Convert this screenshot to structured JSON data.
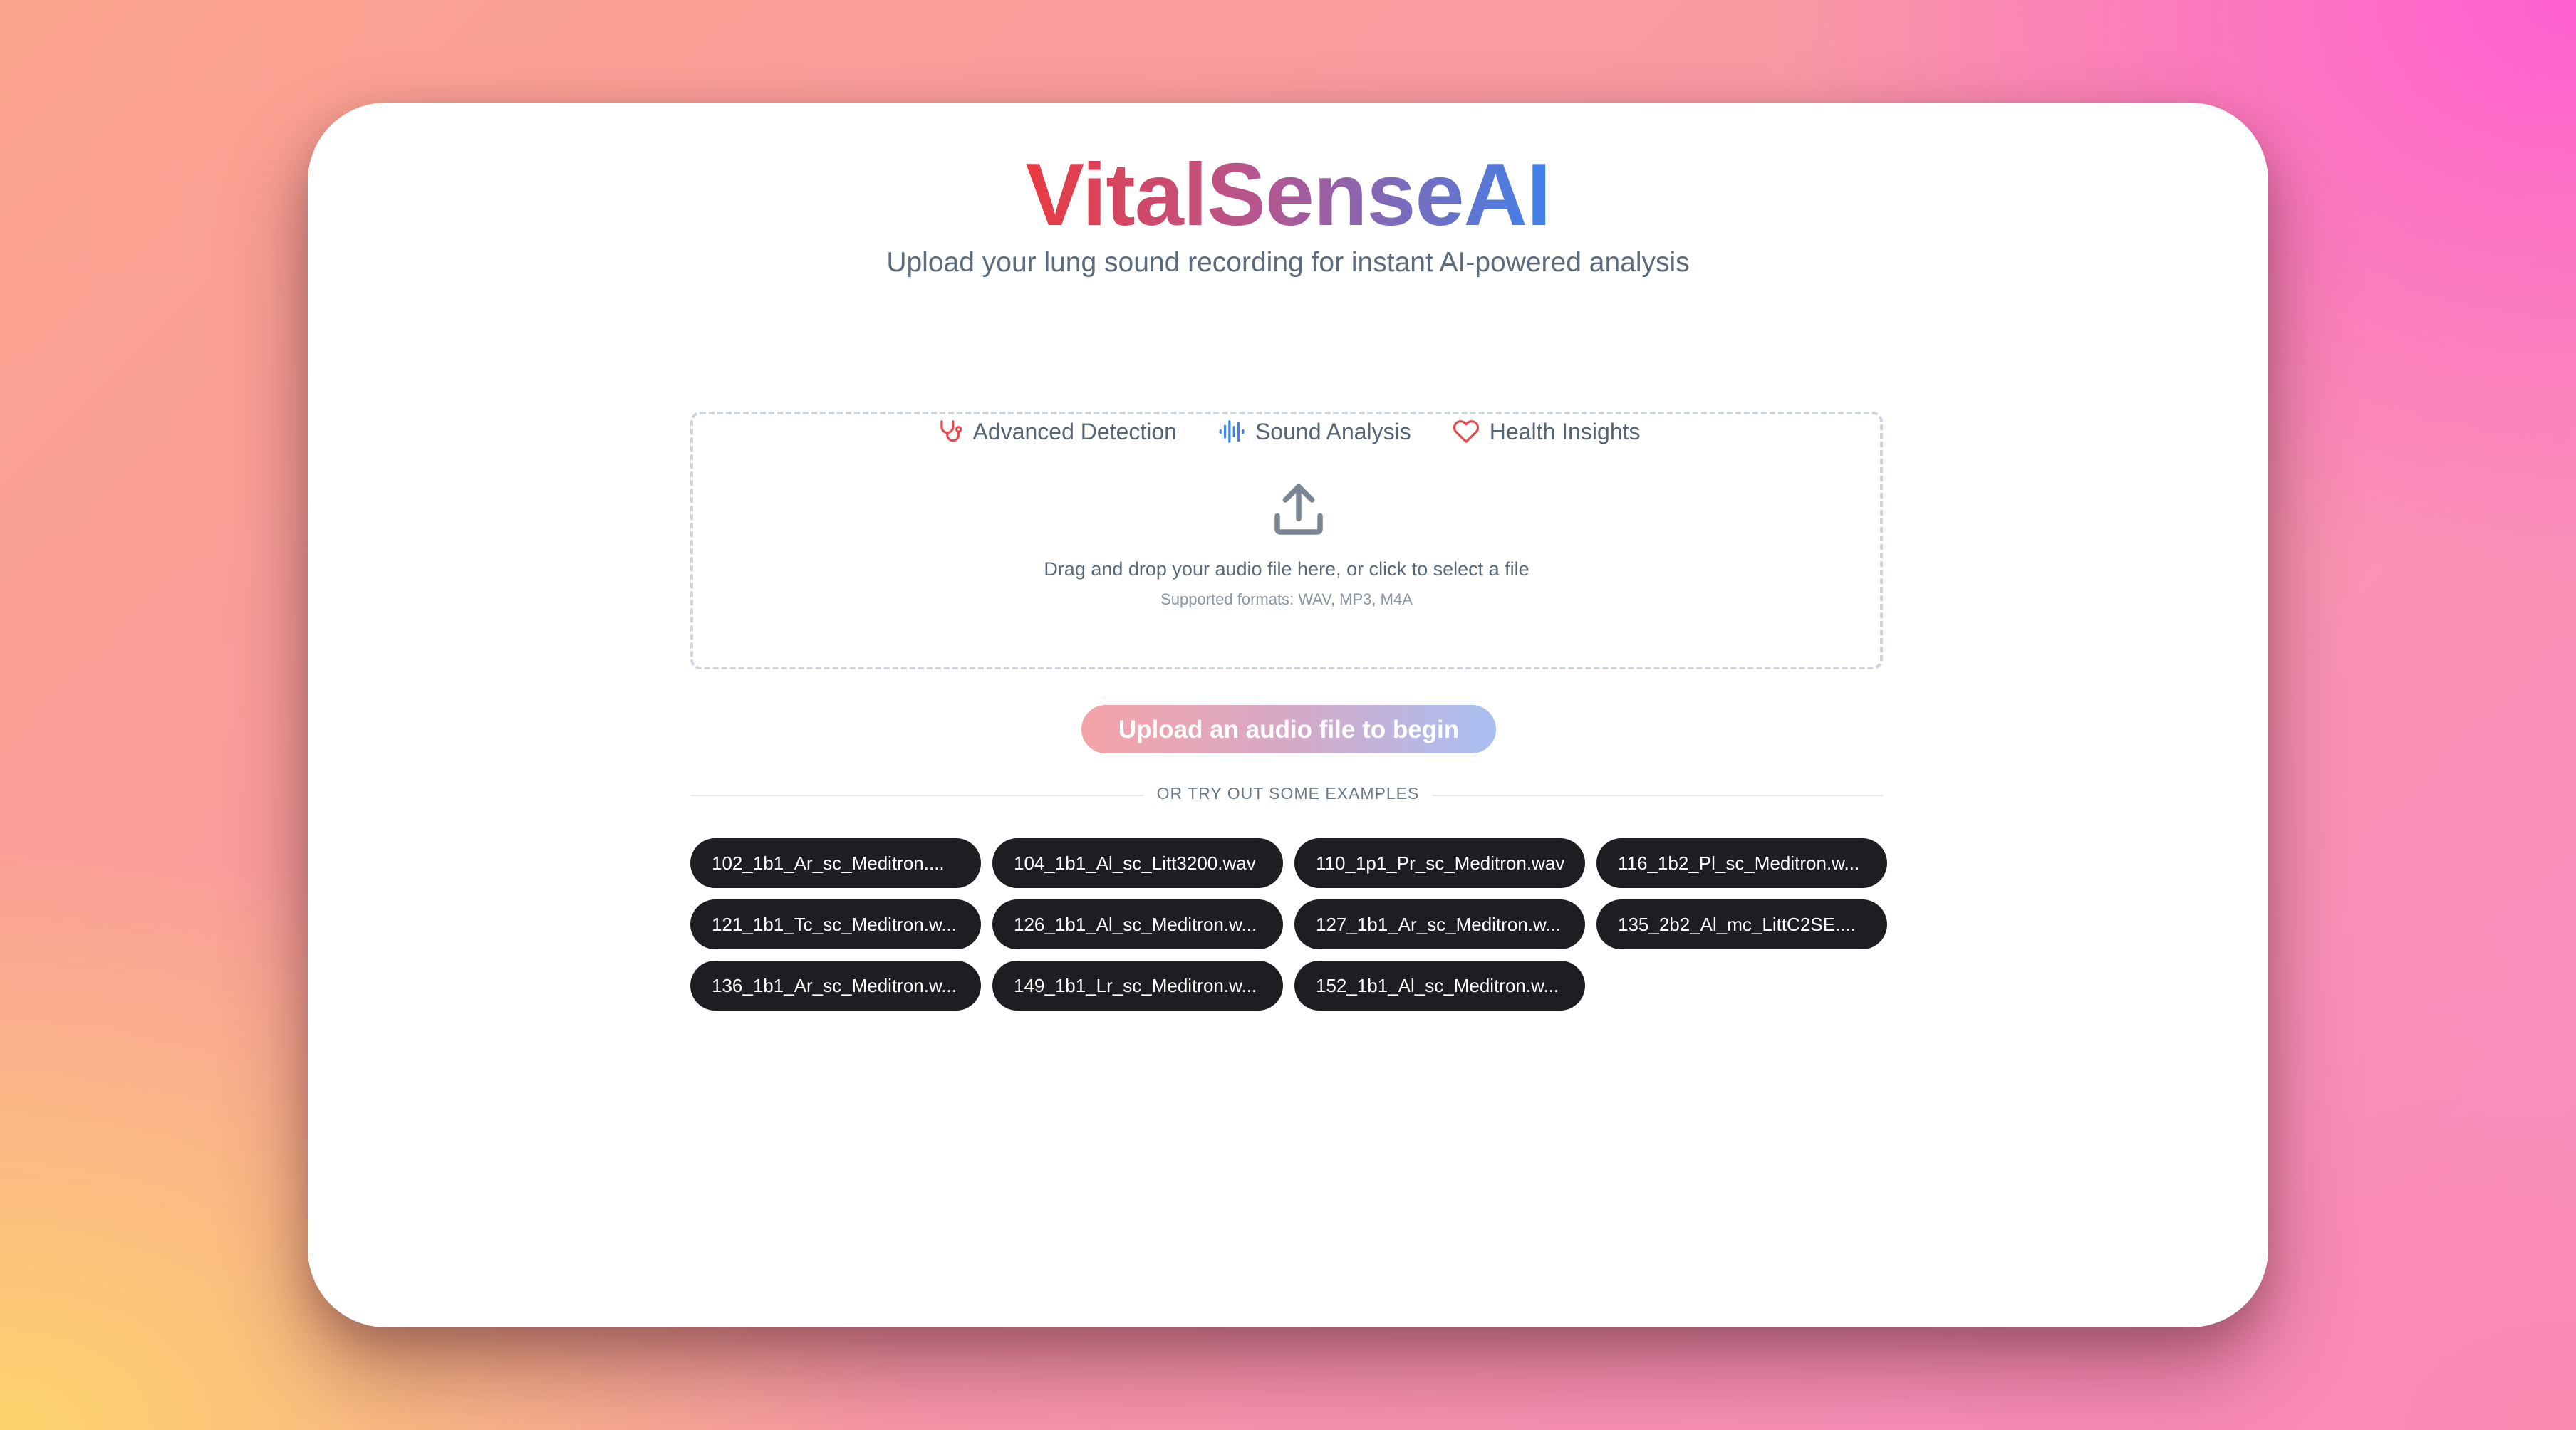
{
  "app": {
    "title": "VitalSenseAI",
    "subtitle": "Upload your lung sound recording for instant AI-powered analysis"
  },
  "features": [
    {
      "label": "Advanced Detection",
      "icon": "stethoscope-icon",
      "color": "#e5484d"
    },
    {
      "label": "Sound Analysis",
      "icon": "waveform-icon",
      "color": "#3b82f6"
    },
    {
      "label": "Health Insights",
      "icon": "heart-icon",
      "color": "#e5484d"
    }
  ],
  "dropzone": {
    "icon": "upload-icon",
    "instruction": "Drag and drop your audio file here, or click to select a file",
    "formats": "Supported formats: WAV, MP3, M4A"
  },
  "cta": {
    "label": "Upload an audio file to begin"
  },
  "examples": {
    "heading": "OR TRY OUT SOME EXAMPLES",
    "items": [
      "102_1b1_Ar_sc_Meditron....",
      "104_1b1_Al_sc_Litt3200.wav",
      "110_1p1_Pr_sc_Meditron.wav",
      "116_1b2_Pl_sc_Meditron.w...",
      "121_1b1_Tc_sc_Meditron.w...",
      "126_1b1_Al_sc_Meditron.w...",
      "127_1b1_Ar_sc_Meditron.w...",
      "135_2b2_Al_mc_LittC2SE....",
      "136_1b1_Ar_sc_Meditron.w...",
      "149_1b1_Lr_sc_Meditron.w...",
      "152_1b1_Al_sc_Meditron.w..."
    ]
  },
  "colors": {
    "title_gradient_start": "#ea3b41",
    "title_gradient_end": "#3f82ea",
    "chip_background": "#1d1e22"
  }
}
